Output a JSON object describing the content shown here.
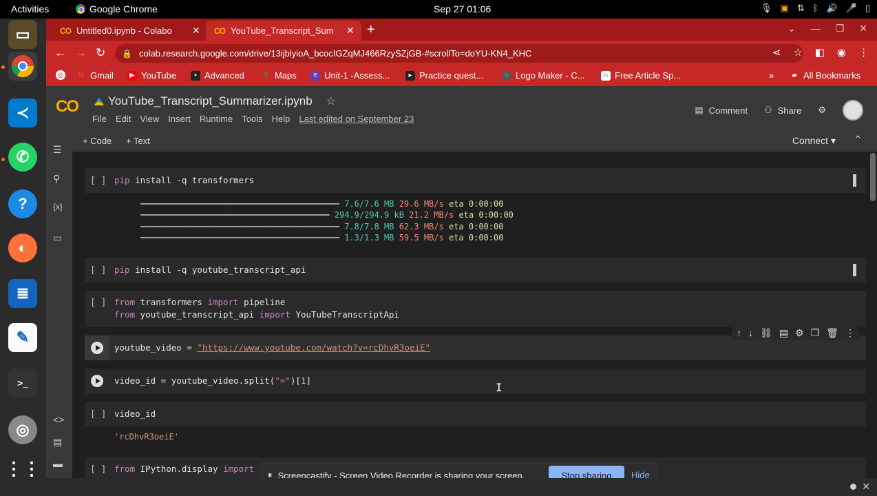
{
  "system_bar": {
    "activities": "Activities",
    "app_name": "Google Chrome",
    "clock": "Sep 27  01:06"
  },
  "browser": {
    "tabs": [
      {
        "label": "Untitled0.ipynb - Colabo",
        "active": false
      },
      {
        "label": "YouTube_Transcript_Sum",
        "active": true
      }
    ],
    "url": "colab.research.google.com/drive/13ijblyioA_bcocIGZqMJ466RzySZjGB-#scrollTo=doYU-KN4_KHC",
    "bookmarks": [
      "Gmail",
      "YouTube",
      "Advanced",
      "Maps",
      "Unit-1 -Assess...",
      "Practice quest...",
      "Logo Maker - C...",
      "Free Article Sp..."
    ],
    "all_bookmarks": "All Bookmarks"
  },
  "colab": {
    "logo": "CO",
    "notebook_title": "YouTube_Transcript_Summarizer.ipynb",
    "menus": [
      "File",
      "Edit",
      "View",
      "Insert",
      "Runtime",
      "Tools",
      "Help"
    ],
    "last_edited": "Last edited on September 23",
    "comment": "Comment",
    "share": "Share",
    "add_code": "+ Code",
    "add_text": "+ Text",
    "connect": "Connect"
  },
  "cells": {
    "c1": {
      "bracket": "[ ]",
      "code": "install -q transformers",
      "kw": "pip"
    },
    "c1_out": [
      {
        "bar": "━━━━━━━━━━━━━━━━━━━━━━━━━━━━━━━━━━━━━━━━",
        "mb": "7.6/7.6 MB",
        "rate": "29.6 MB/s",
        "eta": "eta 0:00:00"
      },
      {
        "bar": "━━━━━━━━━━━━━━━━━━━━━━━━━━━━━━━━━━━━━━",
        "mb": "294.9/294.9 kB",
        "rate": "21.2 MB/s",
        "eta": "eta 0:00:00"
      },
      {
        "bar": "━━━━━━━━━━━━━━━━━━━━━━━━━━━━━━━━━━━━━━━━",
        "mb": "7.8/7.8 MB",
        "rate": "62.3 MB/s",
        "eta": "eta 0:00:00"
      },
      {
        "bar": "━━━━━━━━━━━━━━━━━━━━━━━━━━━━━━━━━━━━━━━━",
        "mb": "1.3/1.3 MB",
        "rate": "59.5 MB/s",
        "eta": "eta 0:00:00"
      }
    ],
    "c2": {
      "bracket": "[ ]",
      "kw": "pip",
      "code": "install -q youtube_transcript_api"
    },
    "c3": {
      "bracket": "[ ]",
      "l1a": "from",
      "l1b": "transformers",
      "l1c": "import",
      "l1d": "pipeline",
      "l2a": "from",
      "l2b": "youtube_transcript_api",
      "l2c": "import",
      "l2d": "YouTubeTranscriptApi"
    },
    "c4": {
      "code": "youtube_video = ",
      "str": "\"https://www.youtube.com/watch?v=rcDhvR3oeiE\""
    },
    "c5": {
      "code": "video_id = youtube_video.split(",
      "arg": "\"=\"",
      "idx": "1",
      "close": ")[",
      "end": "]"
    },
    "c6": {
      "bracket": "[ ]",
      "code": "video_id",
      "out": "'rcDhvR3oeiE'"
    },
    "c7": {
      "bracket": "[ ]",
      "kw": "from",
      "code": "IPython.display",
      "kw2": "import"
    }
  },
  "screencastify": {
    "message": "Screencastify - Screen Video Recorder is sharing your screen.",
    "stop": "Stop sharing",
    "hide": "Hide"
  }
}
